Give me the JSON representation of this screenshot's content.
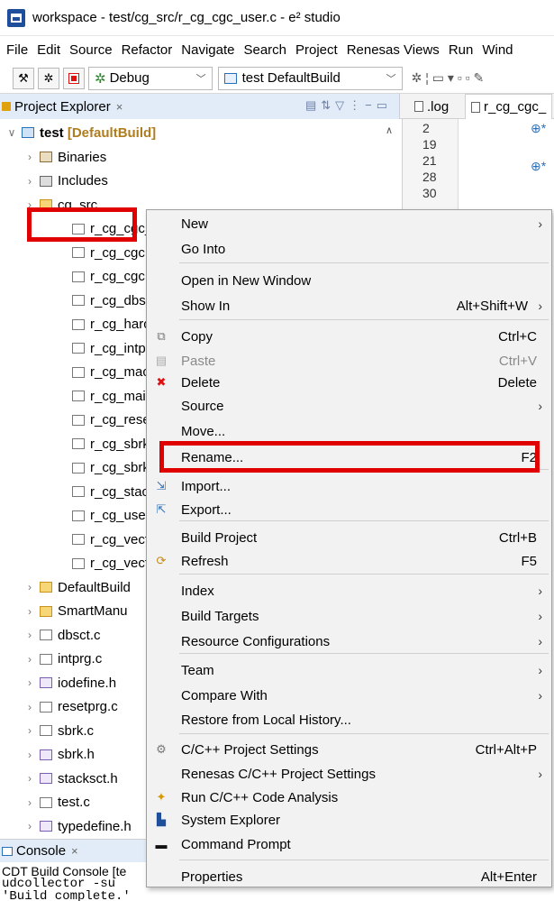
{
  "window": {
    "title": "workspace - test/cg_src/r_cg_cgc_user.c - e² studio"
  },
  "menubar": [
    "File",
    "Edit",
    "Source",
    "Refactor",
    "Navigate",
    "Search",
    "Project",
    "Renesas Views",
    "Run",
    "Wind"
  ],
  "toolbar": {
    "debug_label": "Debug",
    "build_config": "test DefaultBuild"
  },
  "tabs": {
    "explorer_label": "Project Explorer",
    "editor_tabs": [
      ".log",
      "r_cg_cgc_"
    ]
  },
  "tree": {
    "project": {
      "name": "test",
      "config": "[DefaultBuild]"
    },
    "items": [
      {
        "label": "Binaries",
        "icon": "binaries-icon"
      },
      {
        "label": "Includes",
        "icon": "includes-icon"
      },
      {
        "label": "cg_src",
        "icon": "folder-icon"
      },
      {
        "label": "r_cg_cgc_",
        "icon": "c-file-icon"
      },
      {
        "label": "r_cg_cgc.",
        "icon": "c-file-icon"
      },
      {
        "label": "r_cg_cgc.",
        "icon": "c-file-icon"
      },
      {
        "label": "r_cg_dbs",
        "icon": "c-file-icon"
      },
      {
        "label": "r_cg_harc",
        "icon": "c-file-icon"
      },
      {
        "label": "r_cg_intp",
        "icon": "c-file-icon"
      },
      {
        "label": "r_cg_mac",
        "icon": "c-file-icon"
      },
      {
        "label": "r_cg_mai",
        "icon": "c-file-icon"
      },
      {
        "label": "r_cg_rese",
        "icon": "c-file-icon"
      },
      {
        "label": "r_cg_sbrk",
        "icon": "c-file-icon"
      },
      {
        "label": "r_cg_sbrk",
        "icon": "c-file-icon"
      },
      {
        "label": "r_cg_stac",
        "icon": "c-file-icon"
      },
      {
        "label": "r_cg_user",
        "icon": "c-file-icon"
      },
      {
        "label": "r_cg_vect",
        "icon": "c-file-icon"
      },
      {
        "label": "r_cg_vect",
        "icon": "c-file-icon"
      },
      {
        "label": "DefaultBuild",
        "icon": "folder-icon"
      },
      {
        "label": "SmartManu",
        "icon": "folder-icon"
      },
      {
        "label": "dbsct.c",
        "icon": "c-file-icon"
      },
      {
        "label": "intprg.c",
        "icon": "c-file-icon"
      },
      {
        "label": "iodefine.h",
        "icon": "h-file-icon"
      },
      {
        "label": "resetprg.c",
        "icon": "c-file-icon"
      },
      {
        "label": "sbrk.c",
        "icon": "c-file-icon"
      },
      {
        "label": "sbrk.h",
        "icon": "h-file-icon"
      },
      {
        "label": "stacksct.h",
        "icon": "h-file-icon"
      },
      {
        "label": "test.c",
        "icon": "c-file-icon"
      },
      {
        "label": "typedefine.h",
        "icon": "h-file-icon"
      }
    ]
  },
  "editor": {
    "line_numbers": [
      "2",
      "19",
      "21",
      "28",
      "30"
    ],
    "marks": [
      "⊕*",
      "⊕*"
    ]
  },
  "console": {
    "tab_label": "Console",
    "header": "CDT Build Console [te",
    "line1": "udcollector -su",
    "line2": "'Build complete.'"
  },
  "context_menu": [
    {
      "label": "New",
      "shortcut": "",
      "submenu": true,
      "icon": ""
    },
    {
      "label": "Go Into",
      "shortcut": "",
      "submenu": false,
      "icon": ""
    },
    {
      "label": "Open in New Window",
      "shortcut": "",
      "submenu": false,
      "icon": ""
    },
    {
      "label": "Show In",
      "shortcut": "Alt+Shift+W",
      "submenu": true,
      "icon": ""
    },
    {
      "label": "Copy",
      "shortcut": "Ctrl+C",
      "submenu": false,
      "icon": "copy-icon"
    },
    {
      "label": "Paste",
      "shortcut": "Ctrl+V",
      "submenu": false,
      "icon": "paste-icon",
      "disabled": true
    },
    {
      "label": "Delete",
      "shortcut": "Delete",
      "submenu": false,
      "icon": "delete-icon"
    },
    {
      "label": "Source",
      "shortcut": "",
      "submenu": true,
      "icon": ""
    },
    {
      "label": "Move...",
      "shortcut": "",
      "submenu": false,
      "icon": ""
    },
    {
      "label": "Rename...",
      "shortcut": "F2",
      "submenu": false,
      "icon": ""
    },
    {
      "label": "Import...",
      "shortcut": "",
      "submenu": false,
      "icon": "import-icon"
    },
    {
      "label": "Export...",
      "shortcut": "",
      "submenu": false,
      "icon": "export-icon"
    },
    {
      "label": "Build Project",
      "shortcut": "Ctrl+B",
      "submenu": false,
      "icon": ""
    },
    {
      "label": "Refresh",
      "shortcut": "F5",
      "submenu": false,
      "icon": "refresh-icon"
    },
    {
      "label": "Index",
      "shortcut": "",
      "submenu": true,
      "icon": ""
    },
    {
      "label": "Build Targets",
      "shortcut": "",
      "submenu": true,
      "icon": ""
    },
    {
      "label": "Resource Configurations",
      "shortcut": "",
      "submenu": true,
      "icon": ""
    },
    {
      "label": "Team",
      "shortcut": "",
      "submenu": true,
      "icon": ""
    },
    {
      "label": "Compare With",
      "shortcut": "",
      "submenu": true,
      "icon": ""
    },
    {
      "label": "Restore from Local History...",
      "shortcut": "",
      "submenu": false,
      "icon": ""
    },
    {
      "label": "C/C++ Project Settings",
      "shortcut": "Ctrl+Alt+P",
      "submenu": false,
      "icon": "settings-icon"
    },
    {
      "label": "Renesas C/C++ Project Settings",
      "shortcut": "",
      "submenu": true,
      "icon": ""
    },
    {
      "label": "Run C/C++ Code Analysis",
      "shortcut": "",
      "submenu": false,
      "icon": "analysis-icon"
    },
    {
      "label": "System Explorer",
      "shortcut": "",
      "submenu": false,
      "icon": "system-explorer-icon"
    },
    {
      "label": "Command Prompt",
      "shortcut": "",
      "submenu": false,
      "icon": "command-prompt-icon"
    },
    {
      "label": "Properties",
      "shortcut": "Alt+Enter",
      "submenu": false,
      "icon": ""
    }
  ]
}
